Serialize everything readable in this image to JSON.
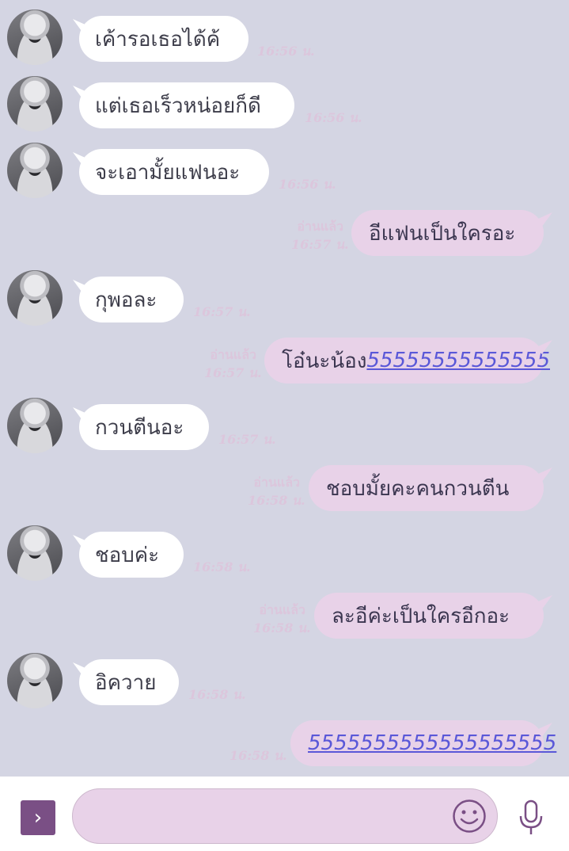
{
  "messages": [
    {
      "side": "in",
      "text": "เค้ารอเธอได้ค้",
      "time": "16:56 น."
    },
    {
      "side": "in",
      "text": "แต่เธอเร็วหน่อยก็ดี",
      "time": "16:56 น."
    },
    {
      "side": "in",
      "text": "จะเอามั้ยแฟนอะ",
      "time": "16:56 น."
    },
    {
      "side": "out",
      "text": "อีแฟนเป็นใครอะ",
      "read": "อ่านแล้ว",
      "time": "16:57 น."
    },
    {
      "side": "in",
      "text": "กุพอละ",
      "time": "16:57 น."
    },
    {
      "side": "out",
      "text": "โอ๋นะน้อง",
      "link": "55555555555555",
      "read": "อ่านแล้ว",
      "time": "16:57 น."
    },
    {
      "side": "in",
      "text": "กวนตีนอะ",
      "time": "16:57 น."
    },
    {
      "side": "out",
      "text": "ชอบมั้ยคะคนกวนตีน",
      "read": "อ่านแล้ว",
      "time": "16:58 น."
    },
    {
      "side": "in",
      "text": "ชอบค่ะ",
      "time": "16:58 น."
    },
    {
      "side": "out",
      "text": "ละอีค่ะเป็นใครอีกอะ",
      "read": "อ่านแล้ว",
      "time": "16:58 น."
    },
    {
      "side": "in",
      "text": "อิควาย",
      "time": "16:58 น."
    },
    {
      "side": "out",
      "link": "5555555555555555555",
      "time": "16:58 น."
    }
  ],
  "footer": {
    "expand_icon": "chevron-right-icon",
    "input_placeholder": "",
    "emoji_icon": "smiley-icon",
    "mic_icon": "microphone-icon"
  },
  "colors": {
    "background": "#d4d5e3",
    "incoming_bubble": "#ffffff",
    "outgoing_bubble": "#e8d2e8",
    "meta_text": "#dcc6dc",
    "link": "#5a58d8",
    "accent": "#7a4f85"
  }
}
